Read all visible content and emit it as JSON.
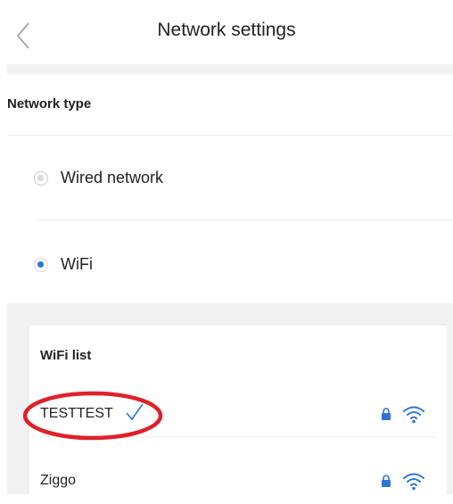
{
  "header": {
    "title": "Network settings",
    "back_icon": "chevron-left-icon"
  },
  "network_type": {
    "heading": "Network type",
    "options": [
      {
        "label": "Wired network",
        "selected": false
      },
      {
        "label": "WiFi",
        "selected": true
      }
    ]
  },
  "wifi_list": {
    "heading": "WiFi list",
    "networks": [
      {
        "ssid": "TESTTEST",
        "connected": true,
        "secured": true,
        "icons": [
          "checkmark-icon",
          "lock-icon",
          "wifi-signal-icon"
        ]
      },
      {
        "ssid": "Ziggo",
        "connected": false,
        "secured": true,
        "icons": [
          "lock-icon",
          "wifi-signal-icon"
        ]
      }
    ]
  },
  "colors": {
    "accent": "#2f73d6",
    "annotation": "#e0202a",
    "text": "#222222",
    "background_gray": "#f1f1f1"
  }
}
